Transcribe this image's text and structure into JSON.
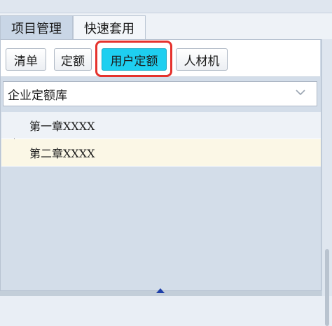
{
  "tabs": [
    {
      "label": "项目管理",
      "active": true
    },
    {
      "label": "快速套用",
      "active": false
    }
  ],
  "toolbar": {
    "buttons": [
      {
        "label": "清单"
      },
      {
        "label": "定额"
      },
      {
        "label": "用户定额",
        "selected": true
      },
      {
        "label": "人材机"
      }
    ],
    "highlight_color": "#e5322d",
    "selected_color": "#1ecff0"
  },
  "library_select": {
    "value": "企业定额库",
    "icon": "chevron-down-icon"
  },
  "tree": {
    "items": [
      {
        "label": "第一章XXXX"
      },
      {
        "label": "第二章XXXX"
      }
    ]
  }
}
